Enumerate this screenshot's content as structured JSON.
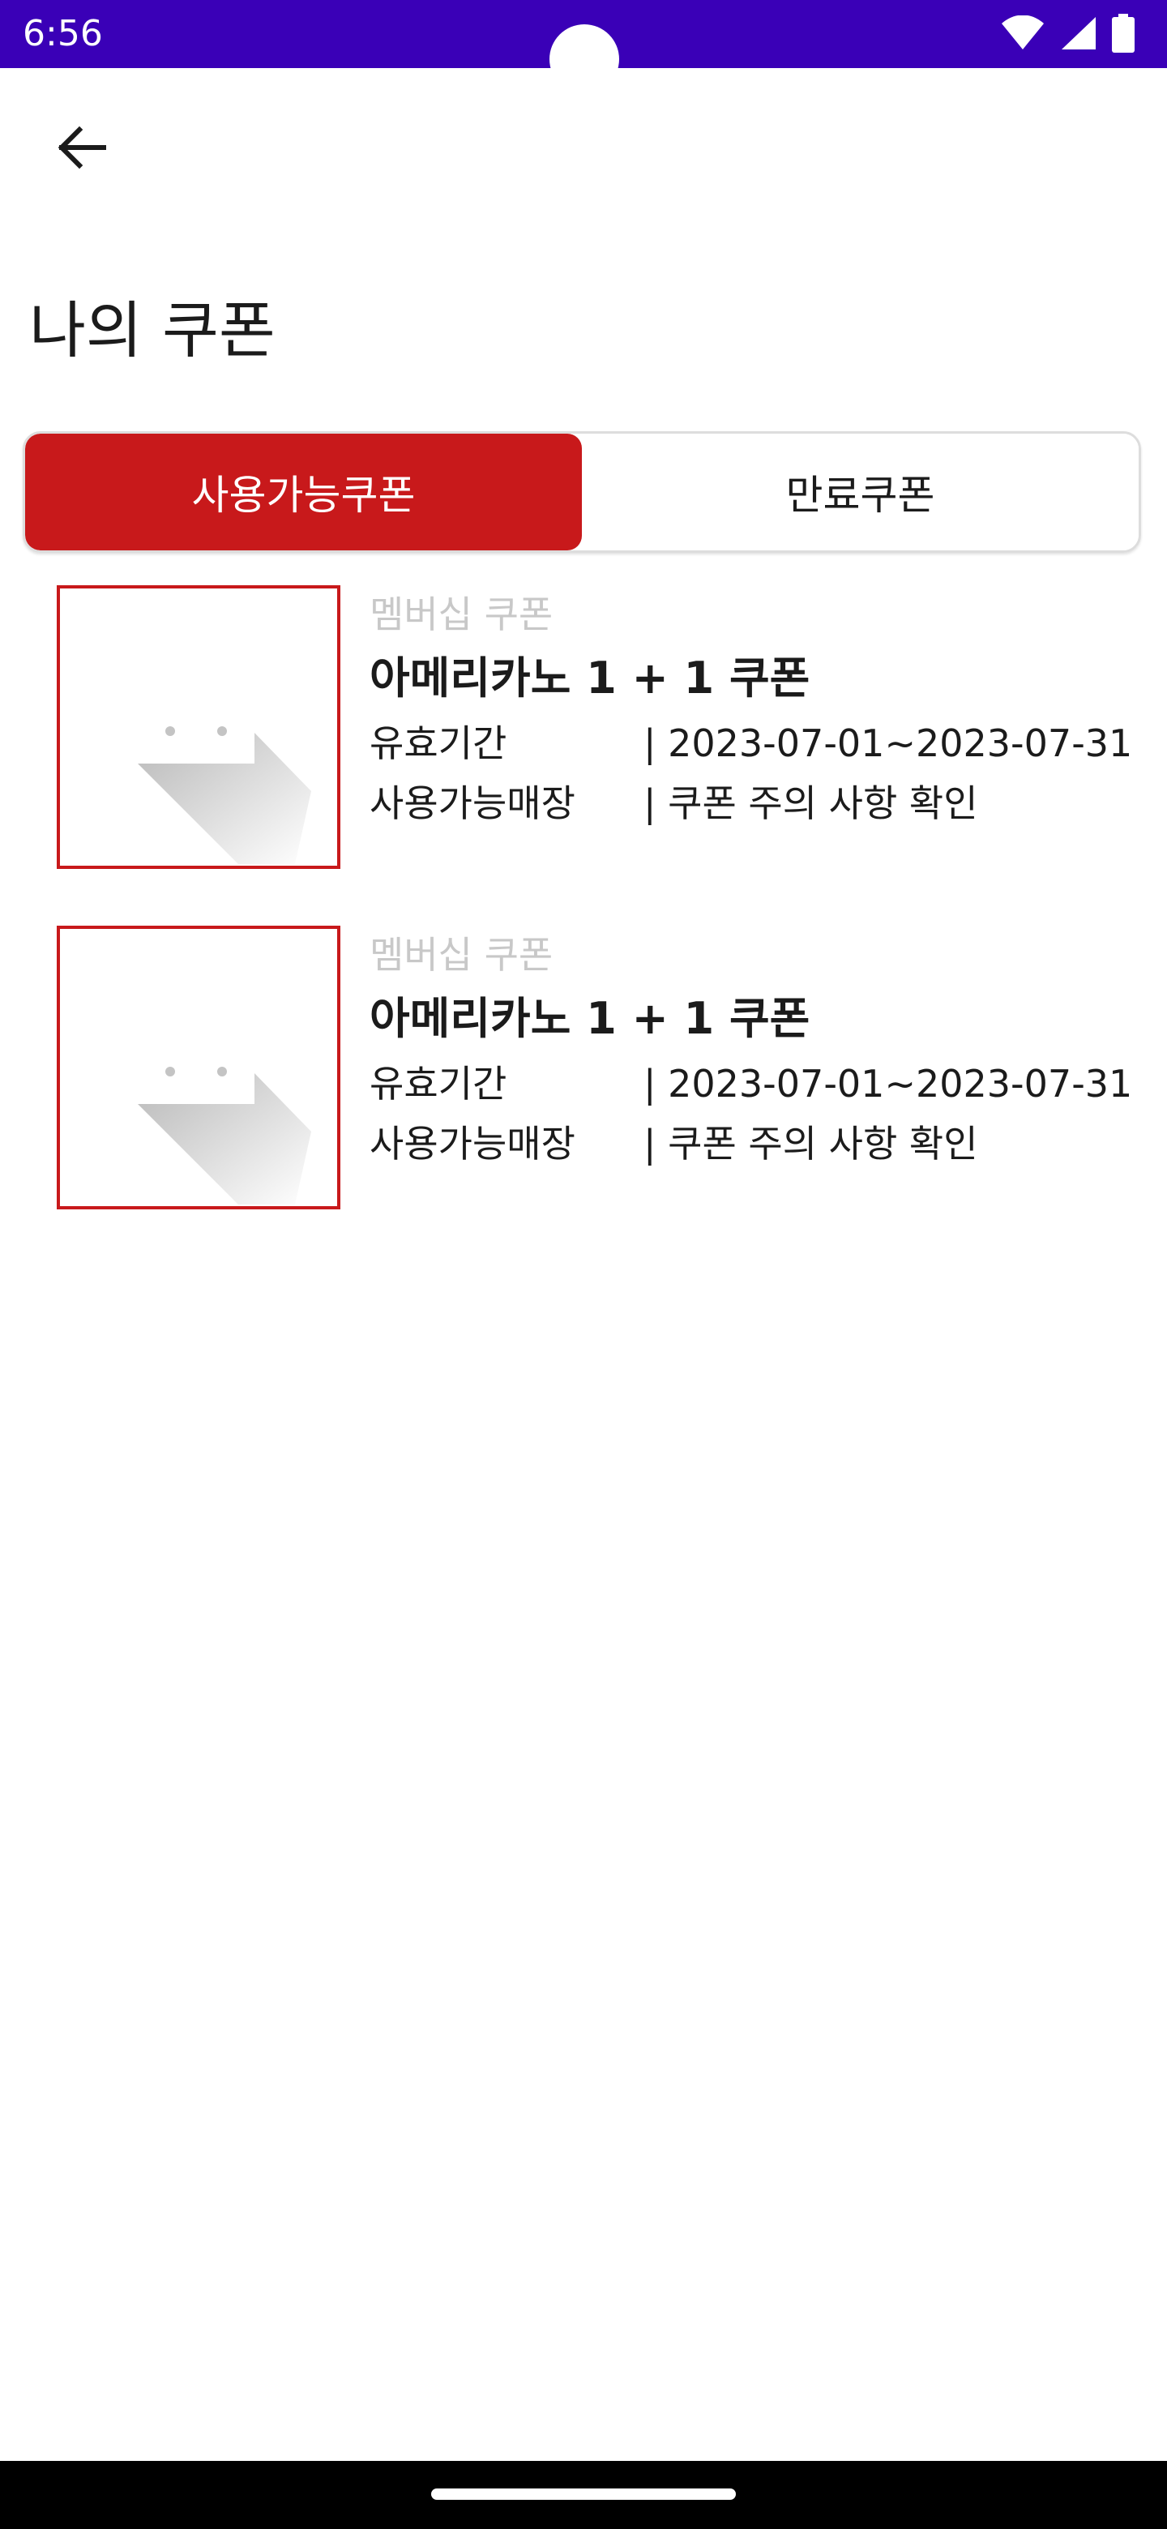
{
  "status_bar": {
    "time": "6:56",
    "background_color": "#3a00b7",
    "icons": [
      "wifi-icon",
      "signal-icon",
      "battery-icon"
    ]
  },
  "app_bar": {
    "back_icon": "arrow-left-icon"
  },
  "page": {
    "title": "나의 쿠폰"
  },
  "tabs": [
    {
      "label": "사용가능쿠폰",
      "selected": true
    },
    {
      "label": "만료쿠폰",
      "selected": false
    }
  ],
  "coupons": [
    {
      "category": "멤버십 쿠폰",
      "name": "아메리카노 1 + 1 쿠폰",
      "validity_label": "유효기간",
      "validity_value": "| 2023-07-01~2023-07-31",
      "stores_label": "사용가능매장",
      "stores_value": "| 쿠폰 주의 사항 확인",
      "image_icon": "broken-image-icon"
    },
    {
      "category": "멤버십 쿠폰",
      "name": "아메리카노 1 + 1 쿠폰",
      "validity_label": "유효기간",
      "validity_value": "| 2023-07-01~2023-07-31",
      "stores_label": "사용가능매장",
      "stores_value": "| 쿠폰 주의 사항 확인",
      "image_icon": "broken-image-icon"
    }
  ],
  "colors": {
    "accent": "#c8191b",
    "muted_text": "#c8c8c8",
    "text": "#1b1b1b"
  }
}
